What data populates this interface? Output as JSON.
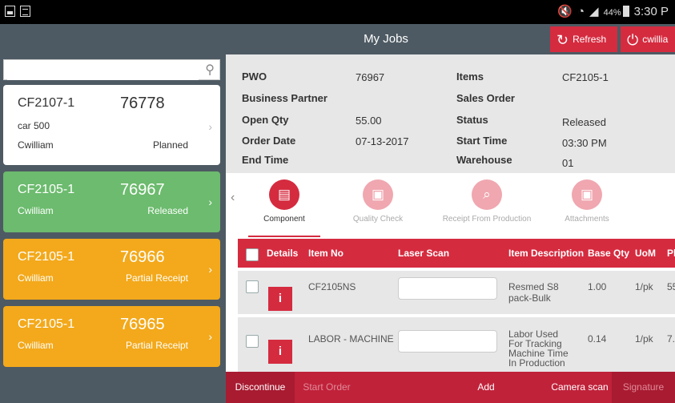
{
  "status_bar": {
    "battery": "44%",
    "time": "3:30 P"
  },
  "header": {
    "title": "My Jobs",
    "refresh_label": "Refresh",
    "user_label": "cwillia"
  },
  "search": {
    "placeholder": ""
  },
  "jobs": [
    {
      "code": "CF2107-1",
      "number": "76778",
      "product": "car 500",
      "user": "Cwilliam",
      "status": "Planned",
      "color": "#ffffff"
    },
    {
      "code": "CF2105-1",
      "number": "76967",
      "user": "Cwilliam",
      "status": "Released",
      "color": "#6cbb6e"
    },
    {
      "code": "CF2105-1",
      "number": "76966",
      "user": "Cwilliam",
      "status": "Partial Receipt",
      "color": "#f3a91b"
    },
    {
      "code": "CF2105-1",
      "number": "76965",
      "user": "Cwilliam",
      "status": "Partial Receipt",
      "color": "#f3a91b"
    }
  ],
  "details": {
    "labels": {
      "pwo": "PWO",
      "business_partner": "Business Partner",
      "open_qty": "Open Qty",
      "order_date": "Order Date",
      "end_time": "End Time",
      "items": "Items",
      "sales_order": "Sales Order",
      "status": "Status",
      "start_time": "Start Time",
      "warehouse": "Warehouse"
    },
    "values": {
      "pwo": "76967",
      "business_partner": "",
      "open_qty": "55.00",
      "order_date": "07-13-2017",
      "end_time": "",
      "items": "CF2105-1",
      "sales_order": "",
      "status": "Released",
      "start_time": "03:30 PM",
      "warehouse": "01"
    }
  },
  "tabs": [
    {
      "label": "Component",
      "icon": "component-icon",
      "active": true
    },
    {
      "label": "Quality Check",
      "icon": "quality-check-icon",
      "active": false
    },
    {
      "label": "Receipt From Production",
      "icon": "receipt-search-icon",
      "active": false
    },
    {
      "label": "Attachments",
      "icon": "attachments-icon",
      "active": false
    }
  ],
  "table": {
    "headers": {
      "details": "Details",
      "item_no": "Item No",
      "laser_scan": "Laser Scan",
      "item_description": "Item Description",
      "base_qty": "Base Qty",
      "uom": "UoM",
      "pl": "Pl"
    },
    "rows": [
      {
        "item_no": "CF2105NS",
        "description": "Resmed S8 pack-Bulk",
        "base_qty": "1.00",
        "uom": "1/pk",
        "pl": "55",
        "info": "i"
      },
      {
        "item_no": "LABOR - MACHINE",
        "description": "Labor Used For Tracking Machine Time In Production",
        "base_qty": "0.14",
        "uom": "1/pk",
        "pl": "7.",
        "info": "i"
      }
    ]
  },
  "bottom_bar": {
    "discontinue": "Discontinue",
    "start_order": "Start Order",
    "add": "Add",
    "camera_scan": "Camera scan",
    "signature": "Signature"
  },
  "colors": {
    "accent": "#d52b3f",
    "panel": "#4e5a63",
    "released": "#6cbb6e",
    "partial": "#f3a91b"
  }
}
